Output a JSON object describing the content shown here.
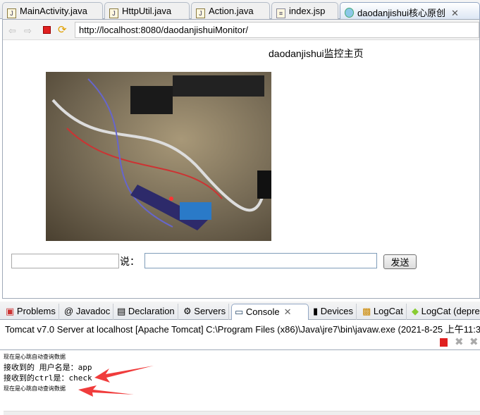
{
  "editor_tabs": [
    {
      "label": "MainActivity.java",
      "icon": "java-file-icon"
    },
    {
      "label": "HttpUtil.java",
      "icon": "java-file-icon"
    },
    {
      "label": "Action.java",
      "icon": "java-file-icon"
    },
    {
      "label": "index.jsp",
      "icon": "jsp-file-icon"
    },
    {
      "label": "daodanjishui核心原创",
      "icon": "globe-icon",
      "active": true
    }
  ],
  "browser": {
    "url": "http://localhost:8080/daodanjishuiMonitor/"
  },
  "page": {
    "title": "daodanjishui监控主页",
    "say_label": "说：",
    "send_label": "发送",
    "name_value": "",
    "message_value": ""
  },
  "panel_tabs": [
    {
      "label": "Problems"
    },
    {
      "label": "Javadoc"
    },
    {
      "label": "Declaration"
    },
    {
      "label": "Servers"
    },
    {
      "label": "Console",
      "active": true
    },
    {
      "label": "Devices"
    },
    {
      "label": "LogCat"
    },
    {
      "label": "LogCat (depre"
    }
  ],
  "console": {
    "header": "Tomcat v7.0 Server at localhost [Apache Tomcat] C:\\Program Files (x86)\\Java\\jre7\\bin\\javaw.exe (2021-8-25 上午11:3",
    "lines": [
      "现在是心跳自动查询数据",
      "接收到的 用户名是：app",
      "接收到的ctrl是：check",
      "现在是心跳自动查询数据"
    ]
  },
  "colors": {
    "arrow": "#f03c3c",
    "stop": "#e02020"
  }
}
